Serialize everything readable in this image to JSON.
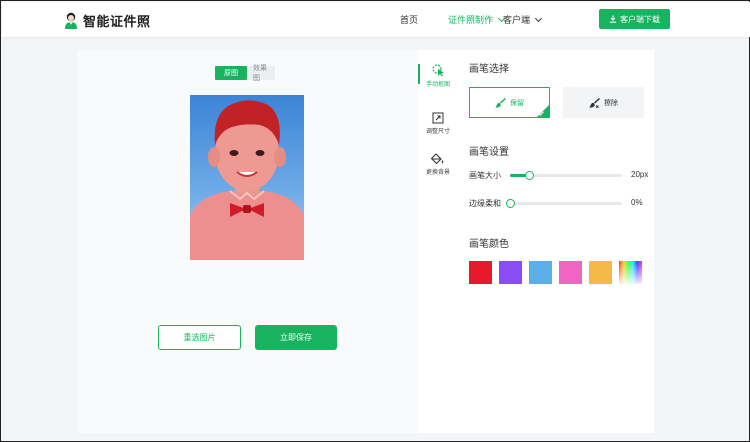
{
  "header": {
    "logo_text": "智能证件照",
    "nav": {
      "home": "首页",
      "make": "证件照制作",
      "client": "客户端"
    },
    "download": "客户端下载"
  },
  "preview": {
    "tab_original": "原图",
    "tab_effect": "效果图",
    "reselect": "重选图片",
    "save": "立即保存"
  },
  "tools": [
    {
      "label": "手动抠图",
      "icon": "cursor-brush-icon",
      "active": true
    },
    {
      "label": "调整尺寸",
      "icon": "resize-icon",
      "active": false
    },
    {
      "label": "更换背景",
      "icon": "paint-bucket-icon",
      "active": false
    }
  ],
  "brush_select": {
    "title": "画笔选择",
    "keep": "保留",
    "erase": "擦除"
  },
  "brush_settings": {
    "title": "画笔设置",
    "size_label": "画笔大小",
    "size_value": "20px",
    "size_fraction": 0.17,
    "soft_label": "边缘柔和",
    "soft_value": "0%",
    "soft_fraction": 0.0
  },
  "brush_color": {
    "title": "画笔颜色",
    "colors": [
      "#e8192c",
      "#8a4cf3",
      "#5aafe9",
      "#f064c4",
      "#f5b94a",
      "rainbow"
    ]
  },
  "accent": "#19b35f"
}
